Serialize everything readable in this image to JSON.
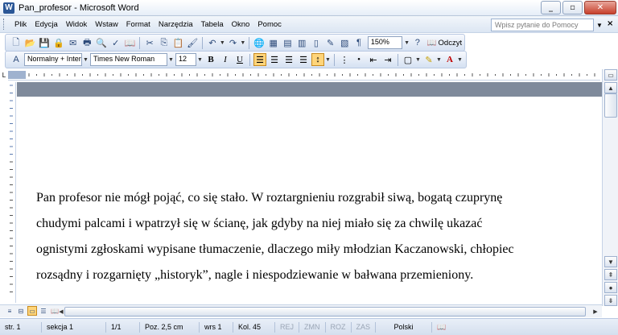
{
  "window": {
    "title": "Pan_profesor - Microsoft Word",
    "app_icon": "W",
    "buttons": [
      "minimize",
      "maximize",
      "close"
    ]
  },
  "menu": {
    "items": [
      "Plik",
      "Edycja",
      "Widok",
      "Wstaw",
      "Format",
      "Narzędzia",
      "Tabela",
      "Okno",
      "Pomoc"
    ],
    "help_placeholder": "Wpisz pytanie do Pomocy",
    "close_label": "×"
  },
  "toolbar_standard": {
    "zoom": "150%",
    "read_label": "Odczyt"
  },
  "toolbar_formatting": {
    "style": "Normalny + Inter",
    "font": "Times New Roman",
    "size": "12",
    "bold": "B",
    "italic": "I",
    "underline": "U"
  },
  "document": {
    "lines": [
      "Pan profesor nie mógł pojąć, co się stało. W roztargnieniu rozgrabił siwą, bogatą czuprynę",
      "chudymi palcami i wpatrzył się w ścianę, jak gdyby na niej miało się za chwilę ukazać",
      "ognistymi zgłoskami wypisane tłumaczenie, dlaczego miły młodzian Kaczanowski, chłopiec",
      "rozsądny i rozgarnięty „historyk”, nagle i niespodziewanie w bałwana przemieniony."
    ]
  },
  "statusbar": {
    "page": "str. 1",
    "section": "sekcja 1",
    "pages": "1/1",
    "position": "Poz. 2,5 cm",
    "line": "wrs 1",
    "column": "Kol. 45",
    "rec": "REJ",
    "trk": "ZMN",
    "ext": "ROZ",
    "ovr": "ZAS",
    "language": "Polski"
  },
  "accent_color": "#2b5797"
}
